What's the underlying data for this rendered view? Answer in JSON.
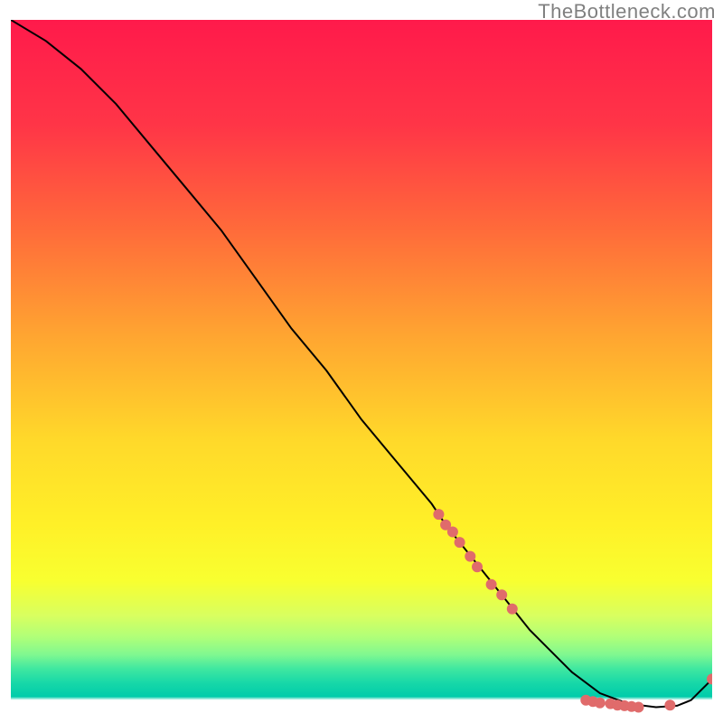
{
  "attribution": "TheBottleneck.com",
  "chart_data": {
    "type": "line",
    "title": "",
    "xlabel": "",
    "ylabel": "",
    "xlim": [
      0,
      100
    ],
    "ylim": [
      0,
      100
    ],
    "background": {
      "kind": "vertical-gradient",
      "stops": [
        {
          "pos": 0.0,
          "color": "#ff1a4b"
        },
        {
          "pos": 0.15,
          "color": "#ff3547"
        },
        {
          "pos": 0.3,
          "color": "#ff6b3a"
        },
        {
          "pos": 0.45,
          "color": "#ffa531"
        },
        {
          "pos": 0.6,
          "color": "#ffd92a"
        },
        {
          "pos": 0.72,
          "color": "#fff028"
        },
        {
          "pos": 0.8,
          "color": "#f8ff30"
        },
        {
          "pos": 0.85,
          "color": "#d8ff60"
        },
        {
          "pos": 0.88,
          "color": "#b0ff78"
        },
        {
          "pos": 0.905,
          "color": "#80f890"
        },
        {
          "pos": 0.925,
          "color": "#40e8a0"
        },
        {
          "pos": 0.945,
          "color": "#18d8a8"
        },
        {
          "pos": 0.965,
          "color": "#00ccaa"
        },
        {
          "pos": 0.97,
          "color": "#ffffff"
        }
      ]
    },
    "series": [
      {
        "name": "bottleneck-curve",
        "stroke": "#000000",
        "x": [
          0,
          5,
          10,
          15,
          20,
          25,
          30,
          35,
          40,
          45,
          50,
          55,
          60,
          62,
          66,
          70,
          74,
          77,
          80,
          84,
          88,
          92,
          95,
          97,
          100
        ],
        "y": [
          100,
          97,
          93,
          88,
          82,
          76,
          70,
          63,
          56,
          50,
          43,
          37,
          31,
          28,
          23,
          18,
          13,
          10,
          7,
          4,
          2.5,
          2,
          2.2,
          3,
          6
        ]
      }
    ],
    "markers": {
      "name": "sample-points",
      "color": "#e06b6b",
      "radius_px": 6,
      "points": [
        {
          "x": 61.0,
          "y": 29.5
        },
        {
          "x": 62.0,
          "y": 28.0
        },
        {
          "x": 63.0,
          "y": 27.0
        },
        {
          "x": 64.0,
          "y": 25.5
        },
        {
          "x": 65.5,
          "y": 23.5
        },
        {
          "x": 66.5,
          "y": 22.0
        },
        {
          "x": 68.5,
          "y": 19.5
        },
        {
          "x": 70.0,
          "y": 18.0
        },
        {
          "x": 71.5,
          "y": 16.0
        },
        {
          "x": 82.0,
          "y": 3.0
        },
        {
          "x": 83.0,
          "y": 2.8
        },
        {
          "x": 84.0,
          "y": 2.6
        },
        {
          "x": 85.5,
          "y": 2.5
        },
        {
          "x": 86.5,
          "y": 2.3
        },
        {
          "x": 87.5,
          "y": 2.2
        },
        {
          "x": 88.5,
          "y": 2.1
        },
        {
          "x": 89.5,
          "y": 2.0
        },
        {
          "x": 94.0,
          "y": 2.3
        },
        {
          "x": 100.0,
          "y": 6.0
        }
      ]
    }
  }
}
